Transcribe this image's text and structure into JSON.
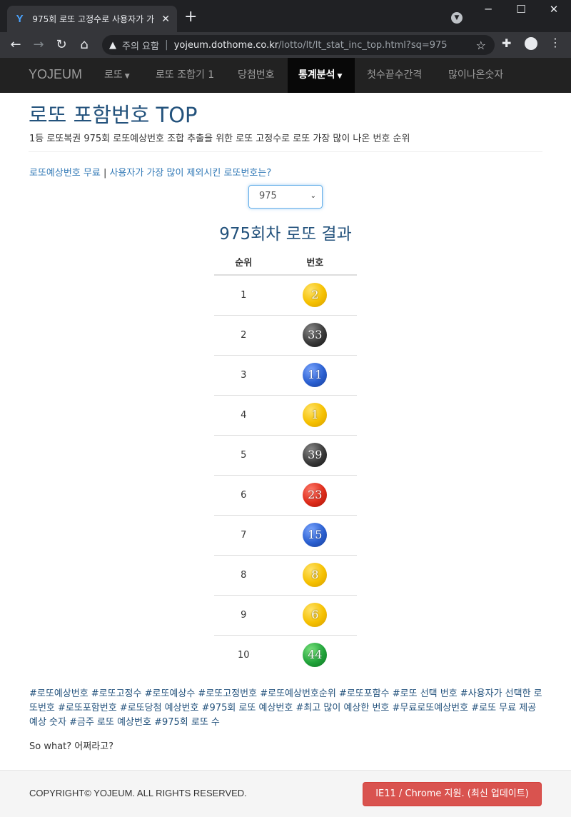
{
  "browser": {
    "tab_title": "975회 로또 고정수로 사용자가 가",
    "tab_close": "✕",
    "new_tab": "+",
    "security_label": "주의 요함",
    "url_host": "yojeum.dothome.co.kr",
    "url_path": "/lotto/lt/lt_stat_inc_top.html?sq=975"
  },
  "navbar": {
    "brand": "YOJEUM",
    "items": [
      {
        "label": "로또",
        "dropdown": true
      },
      {
        "label": "로또 조합기 1"
      },
      {
        "label": "당첨번호"
      },
      {
        "label": "통계분석",
        "dropdown": true,
        "active": true
      },
      {
        "label": "첫수끝수간격"
      },
      {
        "label": "많이나온숫자"
      }
    ]
  },
  "page": {
    "title": "로또 포함번호 TOP",
    "subtitle": "1등 로또복권 975회 로또예상번호 조합 추출을 위한 로또 고정수로 로또 가장 많이 나온 번호 순위",
    "link1": "로또예상번호 무료",
    "link_sep": " | ",
    "link2": "사용자가 가장 많이 제외시킨 로또번호는?",
    "select_value": "975",
    "result_title": "975회차 로또 결과"
  },
  "table": {
    "headers": [
      "순위",
      "번호"
    ],
    "rows": [
      {
        "rank": "1",
        "number": "2",
        "color": "yellow"
      },
      {
        "rank": "2",
        "number": "33",
        "color": "black"
      },
      {
        "rank": "3",
        "number": "11",
        "color": "blue"
      },
      {
        "rank": "4",
        "number": "1",
        "color": "yellow"
      },
      {
        "rank": "5",
        "number": "39",
        "color": "black"
      },
      {
        "rank": "6",
        "number": "23",
        "color": "red"
      },
      {
        "rank": "7",
        "number": "15",
        "color": "blue"
      },
      {
        "rank": "8",
        "number": "8",
        "color": "yellow"
      },
      {
        "rank": "9",
        "number": "6",
        "color": "yellow"
      },
      {
        "rank": "10",
        "number": "44",
        "color": "green"
      }
    ]
  },
  "tags": "#로또예상번호 #로또고정수 #로또예상수 #로또고정번호 #로또예상번호순위 #로또포함수 #로또 선택 번호 #사용자가 선택한 로또번호 #로또포함번호 #로또당첨 예상번호 #975회 로또 예상번호 #최고 많이 예상한 번호 #무료로또예상번호 #로또 무료 제공 예상 숫자 #금주 로또 예상번호 #975회 로또 수",
  "sowhat": "So what? 어쩌라고?",
  "footer": {
    "copyright": "COPYRIGHT© YOJEUM. ALL RIGHTS RESERVED.",
    "button": "IE11 / Chrome 지원. (최신 업데이트)"
  },
  "colors": {
    "navbar_bg": "#222222",
    "link": "#337ab7",
    "title": "#23527c",
    "danger": "#d9534f"
  }
}
